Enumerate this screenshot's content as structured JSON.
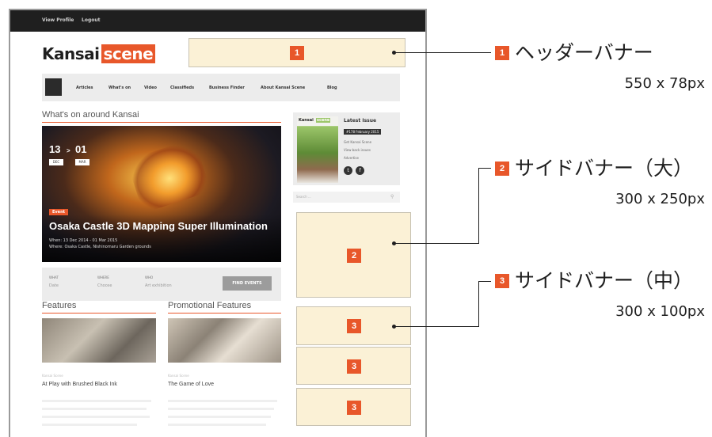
{
  "mockup": {
    "topbar": {
      "links": [
        "View Profile",
        "Logout"
      ]
    },
    "logo": {
      "part1": "Kansai",
      "part2": "scene"
    },
    "nav": {
      "items": [
        "Articles",
        "What's on",
        "Video",
        "Classifieds",
        "Business Finder",
        "About Kansai Scene",
        "Blog"
      ]
    },
    "whats_on": {
      "title": "What's on around Kansai",
      "hero": {
        "day_start": "13",
        "arrow": ">",
        "day_end": "01",
        "month_start": "DEC",
        "month_end": "MAR",
        "tag": "Event",
        "title": "Osaka Castle 3D Mapping Super Illumination",
        "when": "When: 13 Dec 2014 - 01 Mar 2015",
        "where": "Where: Osaka Castle, Nishinomaru Garden grounds"
      },
      "search": {
        "fields": [
          {
            "label": "WHAT",
            "value": "Date"
          },
          {
            "label": "WHERE",
            "value": "Choose"
          },
          {
            "label": "WHO",
            "value": "Art exhibition"
          }
        ],
        "button": "FIND EVENTS"
      }
    },
    "features": {
      "title": "Features",
      "subtitle": "Kansai Scene",
      "article_title": "At Play with Brushed Black Ink"
    },
    "promo": {
      "title": "Promotional Features",
      "subtitle": "Kansai Scene",
      "article_title": "The Game of Love"
    },
    "latest_issue": {
      "cover_title": "Kansai",
      "cover_accent": "scene",
      "title": "Latest Issue",
      "badge": "#178 February 2015",
      "links": [
        "Get Kansai Scene",
        "View back issues",
        "Advertise"
      ],
      "social": [
        "t",
        "f"
      ]
    },
    "side_search": {
      "placeholder": "Search ...",
      "icon": "search-icon"
    },
    "banners": {
      "header": {
        "number": "1"
      },
      "side_large": {
        "number": "2"
      },
      "side_medium": [
        {
          "number": "3"
        },
        {
          "number": "3"
        },
        {
          "number": "3"
        }
      ]
    }
  },
  "annotations": [
    {
      "number": "1",
      "name": "ヘッダーバナー",
      "size": "550 x 78px"
    },
    {
      "number": "2",
      "name": "サイドバナー（大）",
      "size": "300 x 250px"
    },
    {
      "number": "3",
      "name": "サイドバナー（中）",
      "size": "300 x 100px"
    }
  ],
  "colors": {
    "accent": "#e8572a",
    "banner_fill": "#fbf1d6",
    "topbar": "#1f1f1f"
  }
}
